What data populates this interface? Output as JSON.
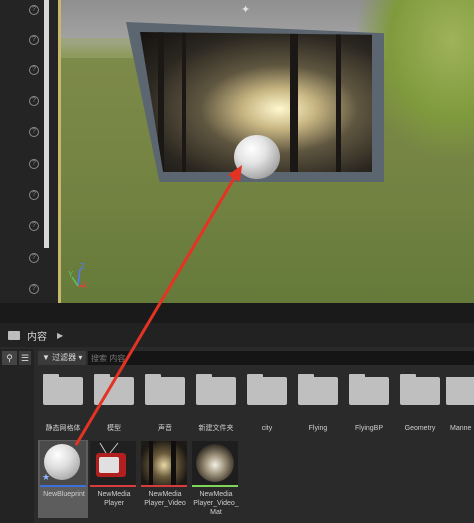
{
  "content_browser": {
    "title": "内容",
    "filter_label": "过滤器",
    "search_placeholder": "搜索 内容",
    "folders": [
      {
        "label": "静态网格体"
      },
      {
        "label": "模型"
      },
      {
        "label": "声音"
      },
      {
        "label": "新建文件夹"
      },
      {
        "label": "city"
      },
      {
        "label": "Flying"
      },
      {
        "label": "FlyingBP"
      },
      {
        "label": "Geometry"
      },
      {
        "label": "Manne"
      }
    ],
    "assets": [
      {
        "label": "NewBlueprint"
      },
      {
        "label": "NewMedia Player"
      },
      {
        "label": "NewMedia Player_Video"
      },
      {
        "label": "NewMedia Player_Video_ Mat"
      }
    ]
  },
  "viewport": {
    "axis": {
      "z": "Z",
      "x": "X",
      "y": "Y"
    }
  },
  "colors": {
    "arrow": "#e53323",
    "selected": "#5d5d5d",
    "blueprint_bar": "#3e6fd8",
    "media_bar": "#d93c3c",
    "mat_bar": "#7fd45a"
  }
}
